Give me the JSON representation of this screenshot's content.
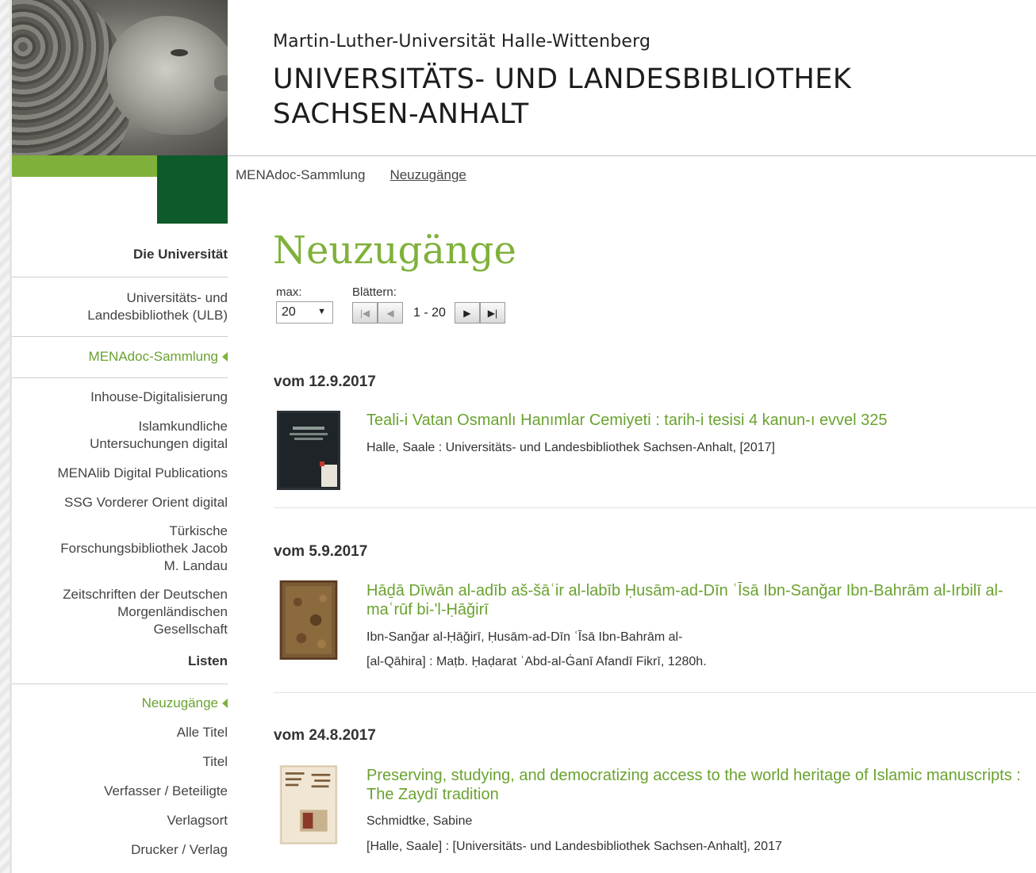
{
  "header": {
    "subtitle": "Martin-Luther-Universität Halle-Wittenberg",
    "title_line1": "UNIVERSITÄTS- UND LANDESBIBLIOTHEK",
    "title_line2": "SACHSEN-ANHALT"
  },
  "breadcrumb": {
    "item1": "MENAdoc-Sammlung",
    "item2": "Neuzugänge"
  },
  "sidebar": {
    "section1": "Die Universität",
    "ulb_line1": "Universitäts- und",
    "ulb_line2": "Landesbibliothek (ULB)",
    "menadoc": "MENAdoc-Sammlung",
    "items": [
      {
        "line1": "Inhouse-Digitalisierung"
      },
      {
        "line1": "Islamkundliche",
        "line2": "Untersuchungen digital"
      },
      {
        "line1": "MENAlib Digital Publications"
      },
      {
        "line1": "SSG Vorderer Orient digital"
      },
      {
        "line1": "Türkische",
        "line2": "Forschungsbibliothek Jacob",
        "line3": "M. Landau"
      },
      {
        "line1": "Zeitschriften der Deutschen",
        "line2": "Morgenländischen",
        "line3": "Gesellschaft"
      }
    ],
    "section2": "Listen",
    "neuzugaenge": "Neuzugänge",
    "lists": [
      "Alle Titel",
      "Titel",
      "Verfasser / Beteiligte",
      "Verlagsort",
      "Drucker / Verlag"
    ]
  },
  "main": {
    "title": "Neuzugänge",
    "max_label": "max:",
    "max_value": "20",
    "pager_label": "Blättern:",
    "range": "1 - 20"
  },
  "entries": [
    {
      "date": "vom 12.9.2017",
      "title": "Teali-i Vatan Osmanlı Hanımlar Cemiyeti : tarih-i tesisi 4 kanun-ı evvel 325",
      "line1": "Halle, Saale : Universitäts- und Landesbibliothek Sachsen-Anhalt, [2017]"
    },
    {
      "date": "vom 5.9.2017",
      "title": "Hāḏā Dīwān al-adīb aš-šāʿir al-labīb Ḥusām-ad-Dīn ʿĪsā Ibn-Sanǧar Ibn-Bahrām al-Irbilī al-maʿrūf bi-'l-Ḥāǧirī",
      "line1": "Ibn-Sanǧar al-Ḥāǧirī, Ḥusām-ad-Dīn ʿĪsā Ibn-Bahrām al-",
      "line2": "[al-Qāhira] : Maṭb. Ḥaḍarat ʿAbd-al-Ġanī Afandī Fikrī, 1280h."
    },
    {
      "date": "vom 24.8.2017",
      "title": "Preserving, studying, and democratizing access to the world heritage of Islamic manuscripts : The Zaydī tradition",
      "line1": "Schmidtke, Sabine",
      "line2": "[Halle, Saale] : [Universitäts- und Landesbibliothek Sachsen-Anhalt], 2017"
    }
  ],
  "colors": {
    "accent_green": "#7fb13a",
    "dark_green": "#0d5a2a",
    "link_green": "#6aa22f"
  }
}
